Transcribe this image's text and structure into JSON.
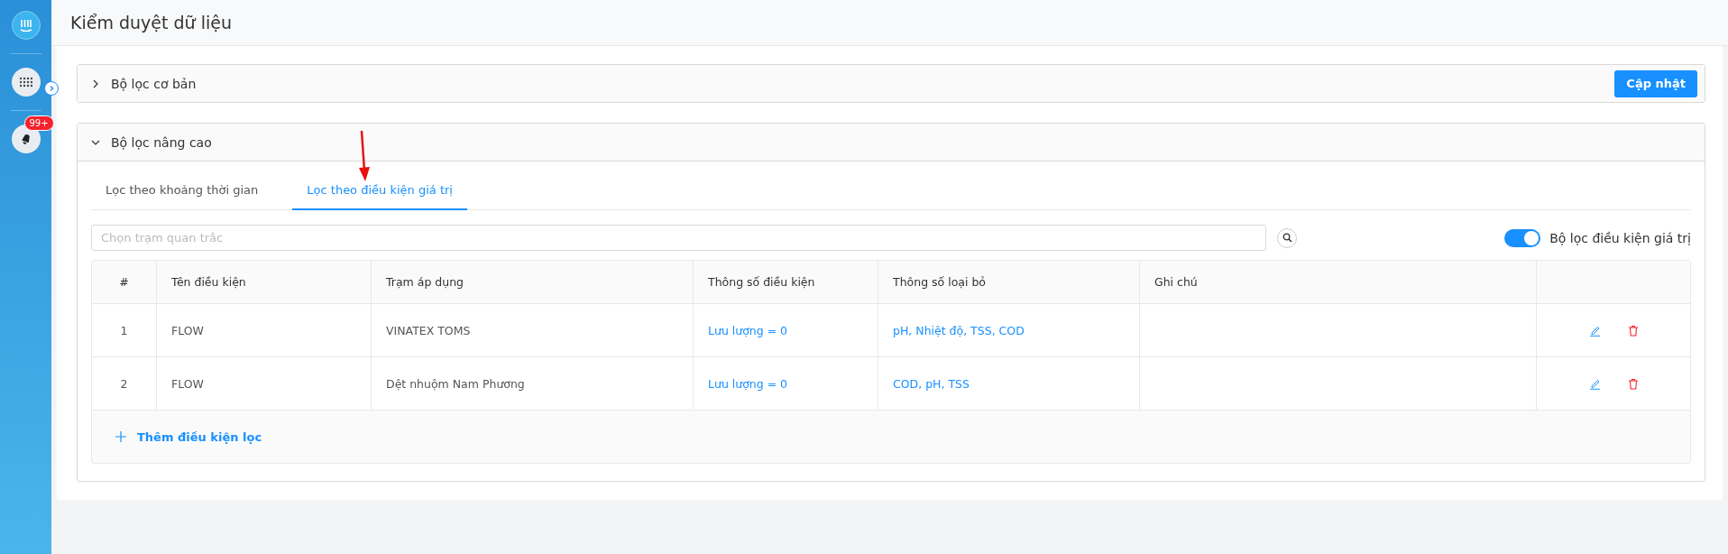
{
  "page_title": "Kiểm duyệt dữ liệu",
  "sidebar": {
    "badge": "99+"
  },
  "basic_filter": {
    "title": "Bộ lọc cơ bản",
    "expanded": false,
    "button": "Cập nhật"
  },
  "advanced_filter": {
    "title": "Bộ lọc nâng cao",
    "expanded": true,
    "tabs": [
      {
        "label": "Lọc theo khoảng thời gian",
        "selected": false
      },
      {
        "label": "Lọc theo điều kiện giá trị",
        "selected": true
      }
    ],
    "search": {
      "placeholder": "Chọn trạm quan trắc"
    },
    "toggle": {
      "label": "Bộ lọc điều kiện giá trị",
      "on": true
    },
    "table": {
      "columns": [
        "#",
        "Tên điều kiện",
        "Trạm áp dụng",
        "Thông số điều kiện",
        "Thông số loại bỏ",
        "Ghi chú"
      ],
      "rows": [
        {
          "index": "1",
          "name": "FLOW",
          "station": "VINATEX TOMS",
          "condition": "Lưu lượng = 0",
          "removed": "pH, Nhiệt độ, TSS, COD"
        },
        {
          "index": "2",
          "name": "FLOW",
          "station": "Dệt nhuộm Nam Phương",
          "condition": "Lưu lượng = 0",
          "removed": "COD, pH, TSS"
        }
      ],
      "add_button": "Thêm điều kiện lọc"
    }
  }
}
